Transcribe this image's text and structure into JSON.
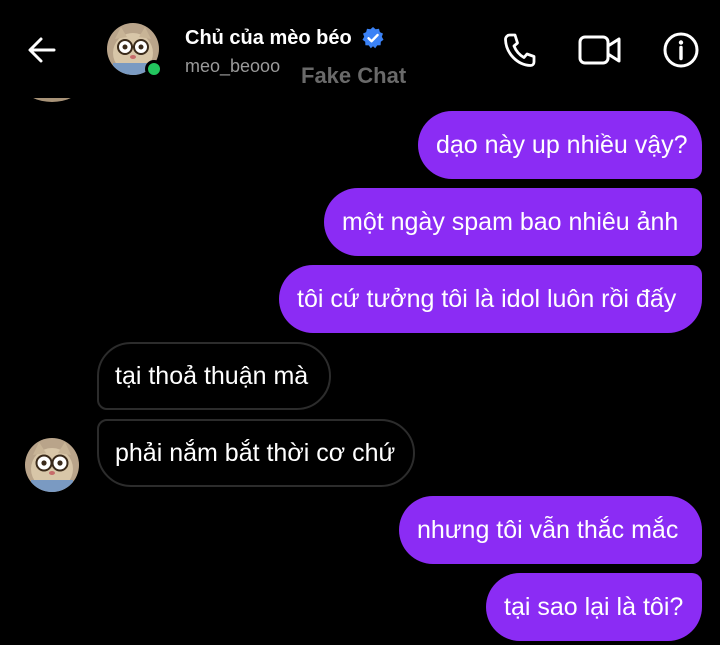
{
  "header": {
    "back_icon": "arrow-left-icon",
    "contact_name": "Chủ của mèo béo",
    "verified_icon": "verified-badge-icon",
    "username": "meo_beooo",
    "watermark": "Fake Chat",
    "online_status_color": "#22c55e",
    "actions": [
      {
        "icon": "phone-icon"
      },
      {
        "icon": "video-camera-icon"
      },
      {
        "icon": "info-icon"
      }
    ]
  },
  "colors": {
    "background": "#000000",
    "sent_bubble": "#8b2cf4",
    "received_bubble_border": "#2c2c2c",
    "verified_badge": "#3b82f6"
  },
  "messages": [
    {
      "direction": "sent",
      "text": "dạo này up nhiều vậy?"
    },
    {
      "direction": "sent",
      "text": "một ngày spam bao nhiêu ảnh"
    },
    {
      "direction": "sent",
      "text": "tôi cứ tưởng tôi là idol luôn rồi đấy"
    },
    {
      "direction": "received",
      "text": "tại thoả thuận mà"
    },
    {
      "direction": "received",
      "text": "phải nắm bắt thời cơ chứ"
    },
    {
      "direction": "sent",
      "text": "nhưng tôi vẫn thắc mắc"
    },
    {
      "direction": "sent",
      "text": "tại sao lại là tôi?"
    }
  ]
}
